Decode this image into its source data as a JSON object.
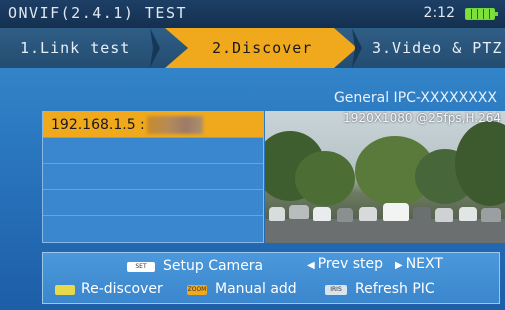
{
  "header": {
    "title": "ONVIF(2.4.1) TEST",
    "clock": "2:12",
    "battery_icon": "battery-full-icon"
  },
  "steps": [
    {
      "label": "1.Link test",
      "active": false
    },
    {
      "label": "2.Discover",
      "active": true
    },
    {
      "label": "3.Video & PTZ",
      "active": false
    }
  ],
  "camera": {
    "name": "General IPC-XXXXXXXX",
    "stream_info": "1920X1080 @25fps,H.264"
  },
  "device_list": {
    "items": [
      {
        "ip": "192.168.1.5 :",
        "selected": true
      },
      {
        "ip": "",
        "selected": false
      },
      {
        "ip": "",
        "selected": false
      },
      {
        "ip": "",
        "selected": false
      },
      {
        "ip": "",
        "selected": false
      }
    ]
  },
  "help": {
    "setup_key": "SET",
    "setup_label": "Setup Camera",
    "prev_label": "Prev step",
    "next_label": "NEXT",
    "rediscover_label": "Re-discover",
    "zoom_key": "ZOOM",
    "manual_label": "Manual add",
    "iris_key": "IRIS",
    "refresh_label": "Refresh PIC"
  },
  "colors": {
    "accent": "#f0a91c",
    "background": "#2b78c0",
    "battery": "#7fe03a"
  }
}
